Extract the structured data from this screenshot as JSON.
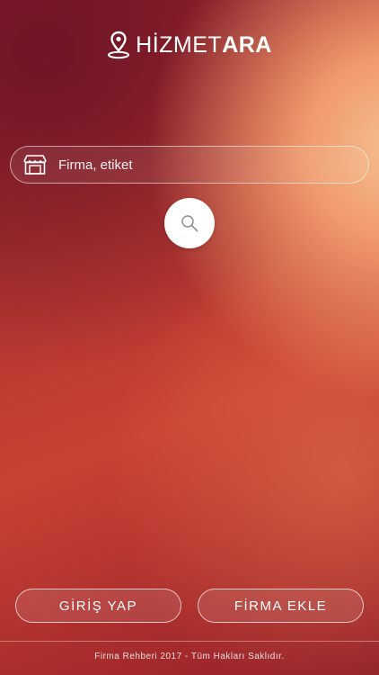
{
  "header": {
    "logo_text_regular": "HİZMET",
    "logo_text_bold": "ARA",
    "logo_icon": "location-pin-icon"
  },
  "search": {
    "placeholder": "Firma, etiket",
    "value": "",
    "leading_icon": "storefront-icon",
    "button_icon": "magnifier-icon"
  },
  "actions": {
    "login_label": "GİRİŞ YAP",
    "add_company_label": "FİRMA EKLE"
  },
  "footer": {
    "copyright": "Firma Rehberi 2017 - Tüm Hakları Saklıdır."
  },
  "colors": {
    "accent": "#ffffff",
    "background_dark": "#8a1d2a",
    "background_mid": "#c84234",
    "background_light": "#f7c08f"
  }
}
